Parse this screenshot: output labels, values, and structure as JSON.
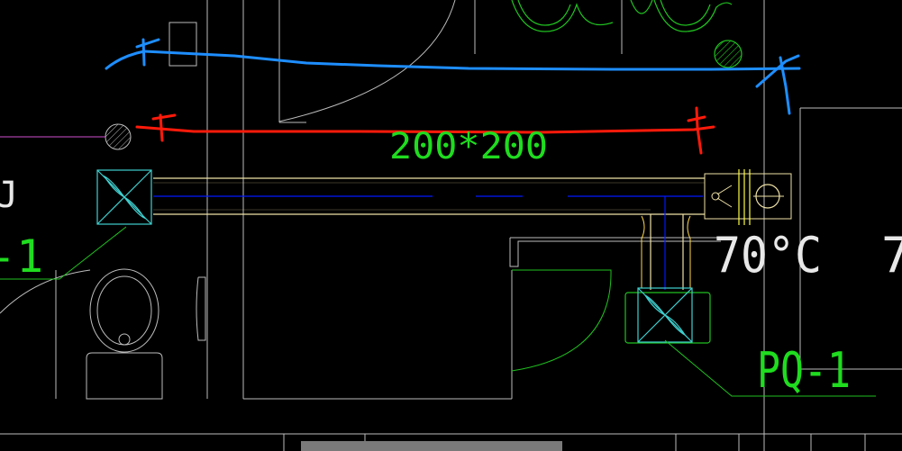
{
  "drawing": {
    "duct_size_label": "200*200",
    "damper_temperature_label": "70°C",
    "edge_fragment_right": "7",
    "equipment_tag": "PQ-1",
    "edge_tag_fragment_left": "-1",
    "edge_char_left": "J"
  },
  "colors": {
    "background": "#000000",
    "walls": "#bcbcbc",
    "duct_outline": "#f0e2a6",
    "duct_centerline": "#0018ff",
    "fan_unit": "#40d0d0",
    "annotation_text": "#1fdc1f",
    "leader_line": "#20c020",
    "sketch_red": "#ff1a0a",
    "sketch_blue": "#1e8eff",
    "dim_line": "#d050d0",
    "damper_yellow": "#ffff40"
  }
}
